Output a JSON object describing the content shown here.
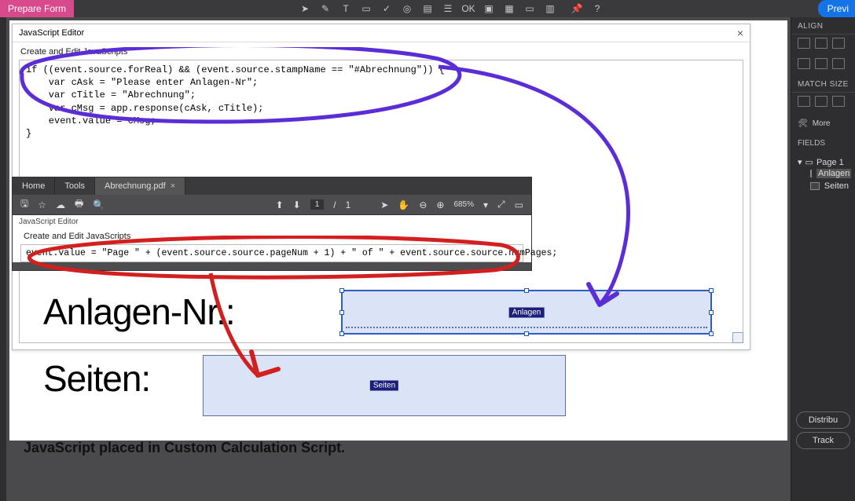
{
  "topbar": {
    "mode_label": "Prepare Form",
    "preview_label": "Previ"
  },
  "rightpanel": {
    "align_label": "ALIGN",
    "match_size_label": "MATCH SIZE",
    "more_label": "More",
    "fields_label": "FIELDS",
    "page_label": "Page 1",
    "field_anlagen": "Anlagen",
    "field_seiten": "Seiten",
    "btn_distribute": "Distribu",
    "btn_track": "Track"
  },
  "jswin1": {
    "title": "JavaScript Editor",
    "fieldset": "Create and Edit JavaScripts",
    "code": "if ((event.source.forReal) && (event.source.stampName == \"#Abrechnung\")) {\n    var cAsk = \"Please enter Anlagen-Nr\";\n    var cTitle = \"Abrechnung\";\n    var cMsg = app.response(cAsk, cTitle);\n    event.value = cMsg;\n}"
  },
  "viewer": {
    "tab_home": "Home",
    "tab_tools": "Tools",
    "tab_file": "Abrechnung.pdf",
    "page_current": "1",
    "page_sep": "/",
    "page_total": "1",
    "zoom": "685%"
  },
  "jswin2": {
    "title": "JavaScript Editor",
    "fieldset": "Create and Edit JavaScripts",
    "code": "event.value = \"Page \" + (event.source.source.pageNum + 1) + \" of \" + event.source.source.numPages;"
  },
  "form": {
    "label_anlagen": "Anlagen-Nr.:",
    "label_seiten": "Seiten:",
    "tag_anlagen": "Anlagen",
    "tag_seiten": "Seiten"
  },
  "caption": "JavaScript placed in Custom Calculation Script.",
  "icons": {
    "pointer": "▲",
    "text": "T",
    "check": "✓",
    "radio": "◎"
  }
}
